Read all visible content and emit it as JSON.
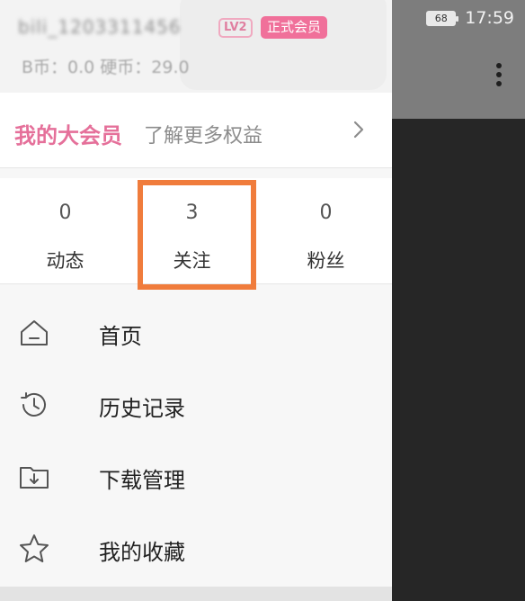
{
  "status_bar": {
    "battery": "68",
    "time": "17:59"
  },
  "header": {
    "username": "bili_1203311456",
    "level_badge": "LV2",
    "member_badge": "正式会员",
    "coins": "B币：0.0   硬币：29.0"
  },
  "vip": {
    "title": "我的大会员",
    "subtitle": "了解更多权益"
  },
  "stats": [
    {
      "value": "0",
      "label": "动态"
    },
    {
      "value": "3",
      "label": "关注"
    },
    {
      "value": "0",
      "label": "粉丝"
    }
  ],
  "menu": [
    {
      "label": "首页",
      "icon": "home-icon"
    },
    {
      "label": "历史记录",
      "icon": "history-icon"
    },
    {
      "label": "下载管理",
      "icon": "download-folder-icon"
    },
    {
      "label": "我的收藏",
      "icon": "star-icon"
    }
  ],
  "colors": {
    "accent_pink": "#e5709a",
    "highlight_orange": "#f07c3c"
  }
}
